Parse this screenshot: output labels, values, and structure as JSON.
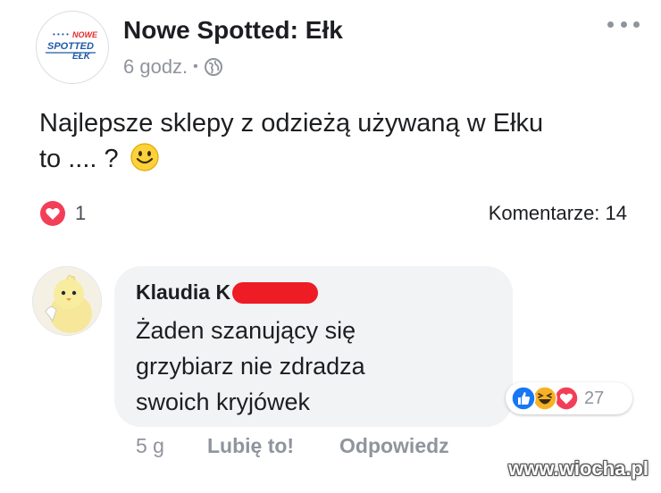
{
  "post": {
    "page_name": "Nowe Spotted: Ełk",
    "time": "6 godz.",
    "meta_separator": "•",
    "text_line1": "Najlepsze sklepy z odzieżą używaną w Ełku",
    "text_line2": "to .... ?",
    "reaction_count": "1",
    "comments_count": "Komentarze: 14",
    "avatar_logo": {
      "line1": "NOWE",
      "line2": "SPOTTED",
      "line3": "EŁK"
    }
  },
  "comment": {
    "author": "Klaudia K",
    "text_line1": "Żaden szanujący się",
    "text_line2": "grzybiarz nie zdradza",
    "text_line3": "swoich kryjówek",
    "reactions": [
      "like-icon",
      "haha-icon",
      "love-icon"
    ],
    "reaction_count": "27",
    "time": "5 g",
    "like_label": "Lubię to!",
    "reply_label": "Odpowiedz"
  },
  "watermark": "www.wiocha.pl",
  "colors": {
    "love": "#f33e58",
    "like": "#1877f2",
    "haha": "#f7b125",
    "redaction": "#ee1c25",
    "logo_blue": "#1f5aa6"
  }
}
